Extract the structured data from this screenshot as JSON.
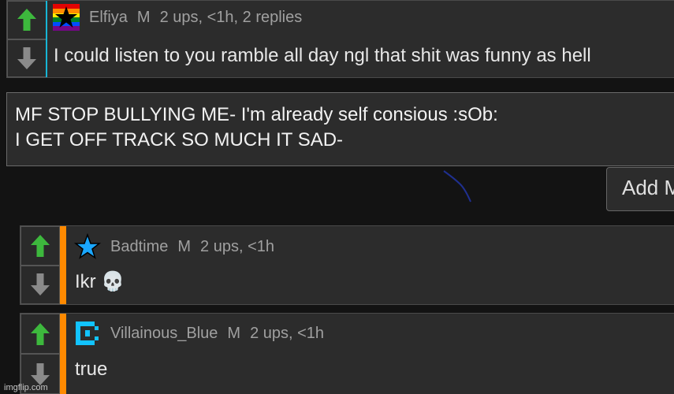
{
  "comments": [
    {
      "username": "Elfiya",
      "gender": "M",
      "stats": "2 ups, <1h, 2 replies",
      "text": "I could listen to you ramble all day ngl that shit was funny as hell",
      "avatar_icon": "rainbow-star-avatar"
    },
    {
      "username": "Badtime",
      "gender": "M",
      "stats": "2 ups, <1h",
      "text": "Ikr 💀",
      "avatar_icon": "blue-star-avatar"
    },
    {
      "username": "Villainous_Blue",
      "gender": "M",
      "stats": "2 ups, <1h",
      "text": "true",
      "avatar_icon": "blue-pixel-c-avatar"
    }
  ],
  "reply_box": {
    "line1": "MF STOP BULLYING ME- I'm already self consious :sOb:",
    "line2": "I GET OFF TRACK SO MUCH IT SAD-"
  },
  "add_button_label": "Add M",
  "watermark": "imgflip.com",
  "colors": {
    "background": "#131313",
    "panel": "#2c2c2c",
    "upvote": "#3db83d",
    "downvote": "#8a8a8a",
    "reply_accent": "#ff8a00",
    "highlight_accent": "#17b6d6",
    "star_blue": "#1aa7ff"
  }
}
